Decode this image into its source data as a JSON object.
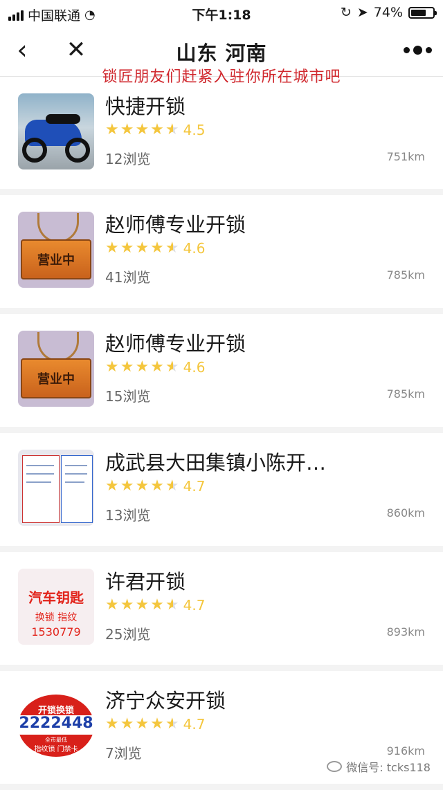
{
  "status_bar": {
    "carrier": "中国联通",
    "time": "下午1:18",
    "battery_percent": "74%",
    "battery_level": 0.74
  },
  "nav": {
    "title": "山东 河南"
  },
  "banner": {
    "text": "锁匠朋友们赶紧入驻你所在城市吧"
  },
  "items": [
    {
      "name": "快捷开锁",
      "rating": "4.5",
      "views": "12浏览",
      "distance": "751km",
      "thumb_type": "moto"
    },
    {
      "name": "赵师傅专业开锁",
      "rating": "4.6",
      "views": "41浏览",
      "distance": "785km",
      "thumb_type": "sign",
      "thumb_text": "营业中"
    },
    {
      "name": "赵师傅专业开锁",
      "rating": "4.6",
      "views": "15浏览",
      "distance": "785km",
      "thumb_type": "sign",
      "thumb_text": "营业中"
    },
    {
      "name": "成武县大田集镇小陈开…",
      "rating": "4.7",
      "views": "13浏览",
      "distance": "860km",
      "thumb_type": "notice"
    },
    {
      "name": "许君开锁",
      "rating": "4.7",
      "views": "25浏览",
      "distance": "893km",
      "thumb_type": "ad",
      "thumb_text": [
        "汽车钥匙",
        "换锁 指纹",
        "1530779"
      ]
    },
    {
      "name": "济宁众安开锁",
      "rating": "4.7",
      "views": "7浏览",
      "distance": "916km",
      "thumb_type": "logo",
      "thumb_text": [
        "开锁换锁",
        "2222448",
        "全市最低",
        "指纹锁 门禁卡"
      ]
    }
  ],
  "watermark": {
    "text": "微信号: tcks118"
  },
  "colors": {
    "star": "#f4c63d",
    "banner": "#d0282e",
    "background": "#f3f3f3"
  }
}
